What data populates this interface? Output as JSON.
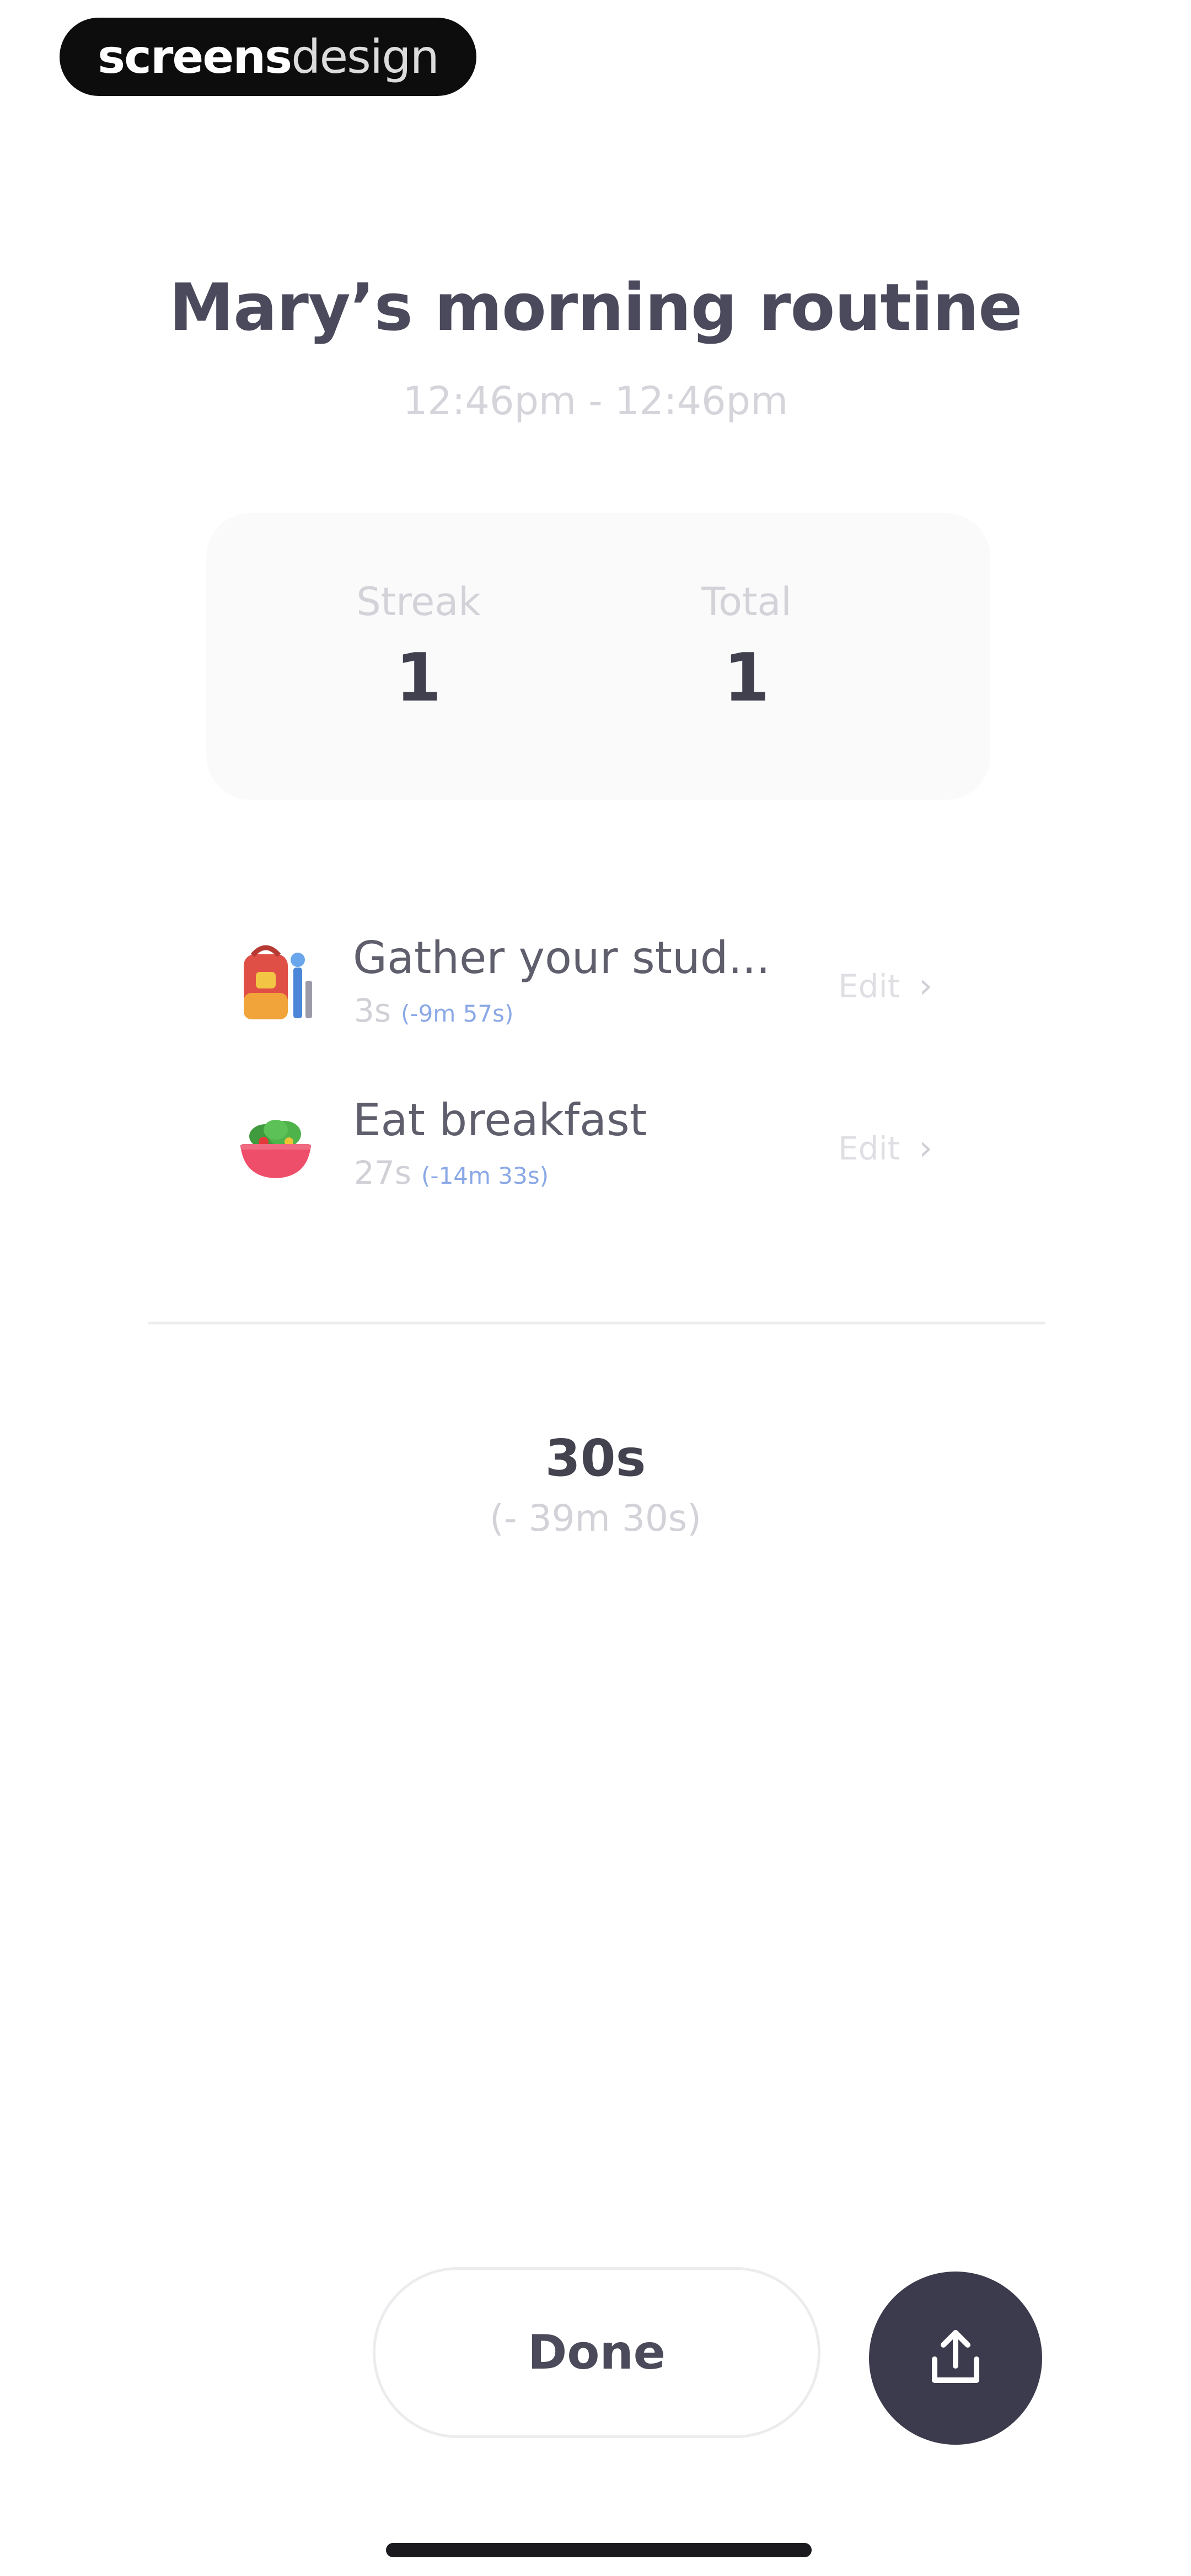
{
  "watermark": {
    "bold_part": "screens",
    "light_part": "design"
  },
  "header": {
    "title": "Mary’s morning routine",
    "time_range": "12:46pm - 12:46pm"
  },
  "stats": {
    "streak_label": "Streak",
    "streak_value": "1",
    "total_label": "Total",
    "total_value": "1"
  },
  "tasks": [
    {
      "icon": "backpack-icon",
      "name": "Gather your stud...",
      "duration": "3s",
      "delta": "(-9m 57s)",
      "edit_label": "Edit"
    },
    {
      "icon": "salad-bowl-icon",
      "name": "Eat breakfast",
      "duration": "27s",
      "delta": "(-14m 33s)",
      "edit_label": "Edit"
    }
  ],
  "summary": {
    "total_time": "30s",
    "total_delta": "(- 39m 30s)"
  },
  "footer": {
    "done_label": "Done"
  },
  "colors": {
    "accent": "#3c3b4d",
    "delta_blue": "#8aa8e6"
  }
}
